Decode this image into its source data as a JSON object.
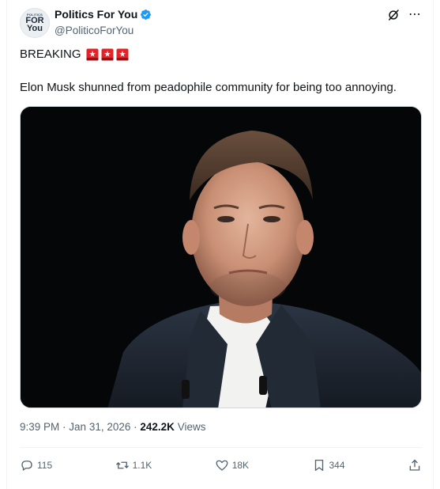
{
  "account": {
    "display_name": "Politics For You",
    "handle": "@PoliticoForYou",
    "avatar_text_small": "POLITICS",
    "avatar_text_big1": "FOR",
    "avatar_text_big2": "You"
  },
  "post": {
    "line1": "BREAKING",
    "line2": "Elon Musk shunned from peadophile community for being too annoying.",
    "time": "9:39 PM",
    "date": "Jan 31, 2026",
    "views_count": "242.2K",
    "views_label": "Views"
  },
  "stats": {
    "replies": "115",
    "reposts": "1.1K",
    "likes": "18K",
    "bookmarks": "344"
  },
  "icons": {
    "verified": "verified-badge-icon",
    "grok": "grok-icon",
    "more": "more-icon",
    "siren": "police-siren-emoji",
    "reply": "reply-icon",
    "repost": "repost-icon",
    "like": "heart-icon",
    "bookmark": "bookmark-icon",
    "share": "share-icon"
  },
  "colors": {
    "verified_blue": "#1d9bf0",
    "text_primary": "#0f1419",
    "text_secondary": "#536471",
    "siren_red": "#e0242a"
  }
}
